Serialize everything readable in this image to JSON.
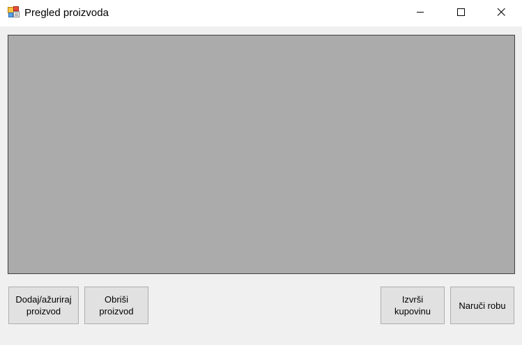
{
  "window": {
    "title": "Pregled proizvoda",
    "app_icon": "form-app-icon",
    "caption_buttons": {
      "minimize": "minimize-icon",
      "maximize": "maximize-icon",
      "close": "close-icon"
    }
  },
  "buttons": {
    "add_update": "Dodaj/ažuriraj\nproizvod",
    "delete": "Obriši\nproizvod",
    "purchase": "Izvrši\nkupovinu",
    "order": "Naruči robu"
  },
  "colors": {
    "grid_background": "#ababab",
    "window_background": "#f0f0f0",
    "button_face": "#e1e1e1"
  }
}
